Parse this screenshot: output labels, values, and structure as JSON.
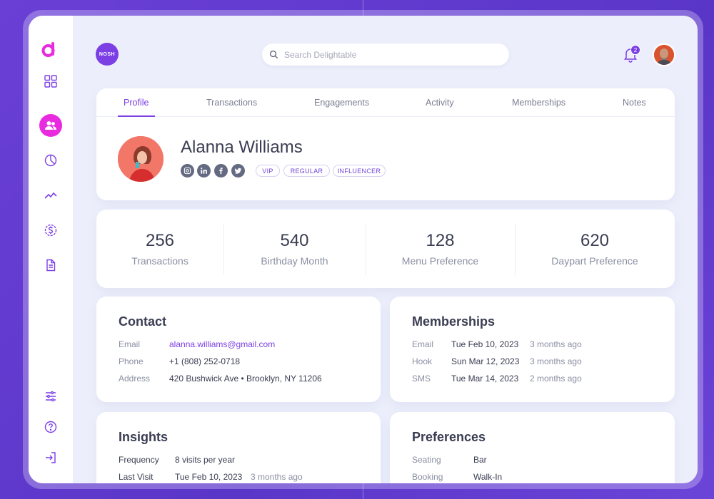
{
  "brand": {
    "badge": "NOSH"
  },
  "search": {
    "placeholder": "Search Delightable"
  },
  "notifications": {
    "count": "2"
  },
  "sidebar": {
    "items": [
      {
        "icon": "dashboard-icon"
      },
      {
        "icon": "users-icon",
        "active": true
      },
      {
        "icon": "pie-chart-icon"
      },
      {
        "icon": "trend-icon"
      },
      {
        "icon": "dollar-icon"
      },
      {
        "icon": "document-icon"
      }
    ],
    "bottom": [
      {
        "icon": "sliders-icon"
      },
      {
        "icon": "help-icon"
      },
      {
        "icon": "logout-icon"
      }
    ]
  },
  "tabs": [
    {
      "label": "Profile",
      "active": true
    },
    {
      "label": "Transactions"
    },
    {
      "label": "Engagements"
    },
    {
      "label": "Activity"
    },
    {
      "label": "Memberships"
    },
    {
      "label": "Notes"
    }
  ],
  "profile": {
    "name": "Alanna Williams",
    "socials": [
      "instagram-icon",
      "linkedin-icon",
      "facebook-icon",
      "twitter-icon"
    ],
    "tags": [
      "VIP",
      "REGULAR",
      "INFLUENCER"
    ]
  },
  "stats": [
    {
      "value": "256",
      "label": "Transactions"
    },
    {
      "value": "540",
      "label": "Birthday Month"
    },
    {
      "value": "128",
      "label": "Menu Preference"
    },
    {
      "value": "620",
      "label": "Daypart Preference"
    }
  ],
  "contact": {
    "title": "Contact",
    "rows": [
      {
        "label": "Email",
        "value": "alanna.williams@gmail.com"
      },
      {
        "label": "Phone",
        "value": "+1 (808) 252-0718"
      },
      {
        "label": "Address",
        "value": "420 Bushwick Ave • Brooklyn, NY 11206"
      }
    ]
  },
  "memberships": {
    "title": "Memberships",
    "rows": [
      {
        "label": "Email",
        "date": "Tue Feb 10, 2023",
        "ago": "3 months ago"
      },
      {
        "label": "Hook",
        "date": "Sun Mar 12, 2023",
        "ago": "3 months ago"
      },
      {
        "label": "SMS",
        "date": "Tue Mar 14, 2023",
        "ago": "2 months ago"
      }
    ]
  },
  "insights": {
    "title": "Insights",
    "rows": [
      {
        "label": "Frequency",
        "value": "8 visits per year",
        "extra": ""
      },
      {
        "label": "Last Visit",
        "value": "Tue Feb 10, 2023",
        "extra": "3 months ago"
      }
    ]
  },
  "preferences": {
    "title": "Preferences",
    "rows": [
      {
        "label": "Seating",
        "value": "Bar"
      },
      {
        "label": "Booking",
        "value": "Walk-In"
      }
    ]
  },
  "colors": {
    "accent": "#7b3fe4",
    "brand_pink": "#e92be0",
    "background": "#6a3fd6"
  }
}
